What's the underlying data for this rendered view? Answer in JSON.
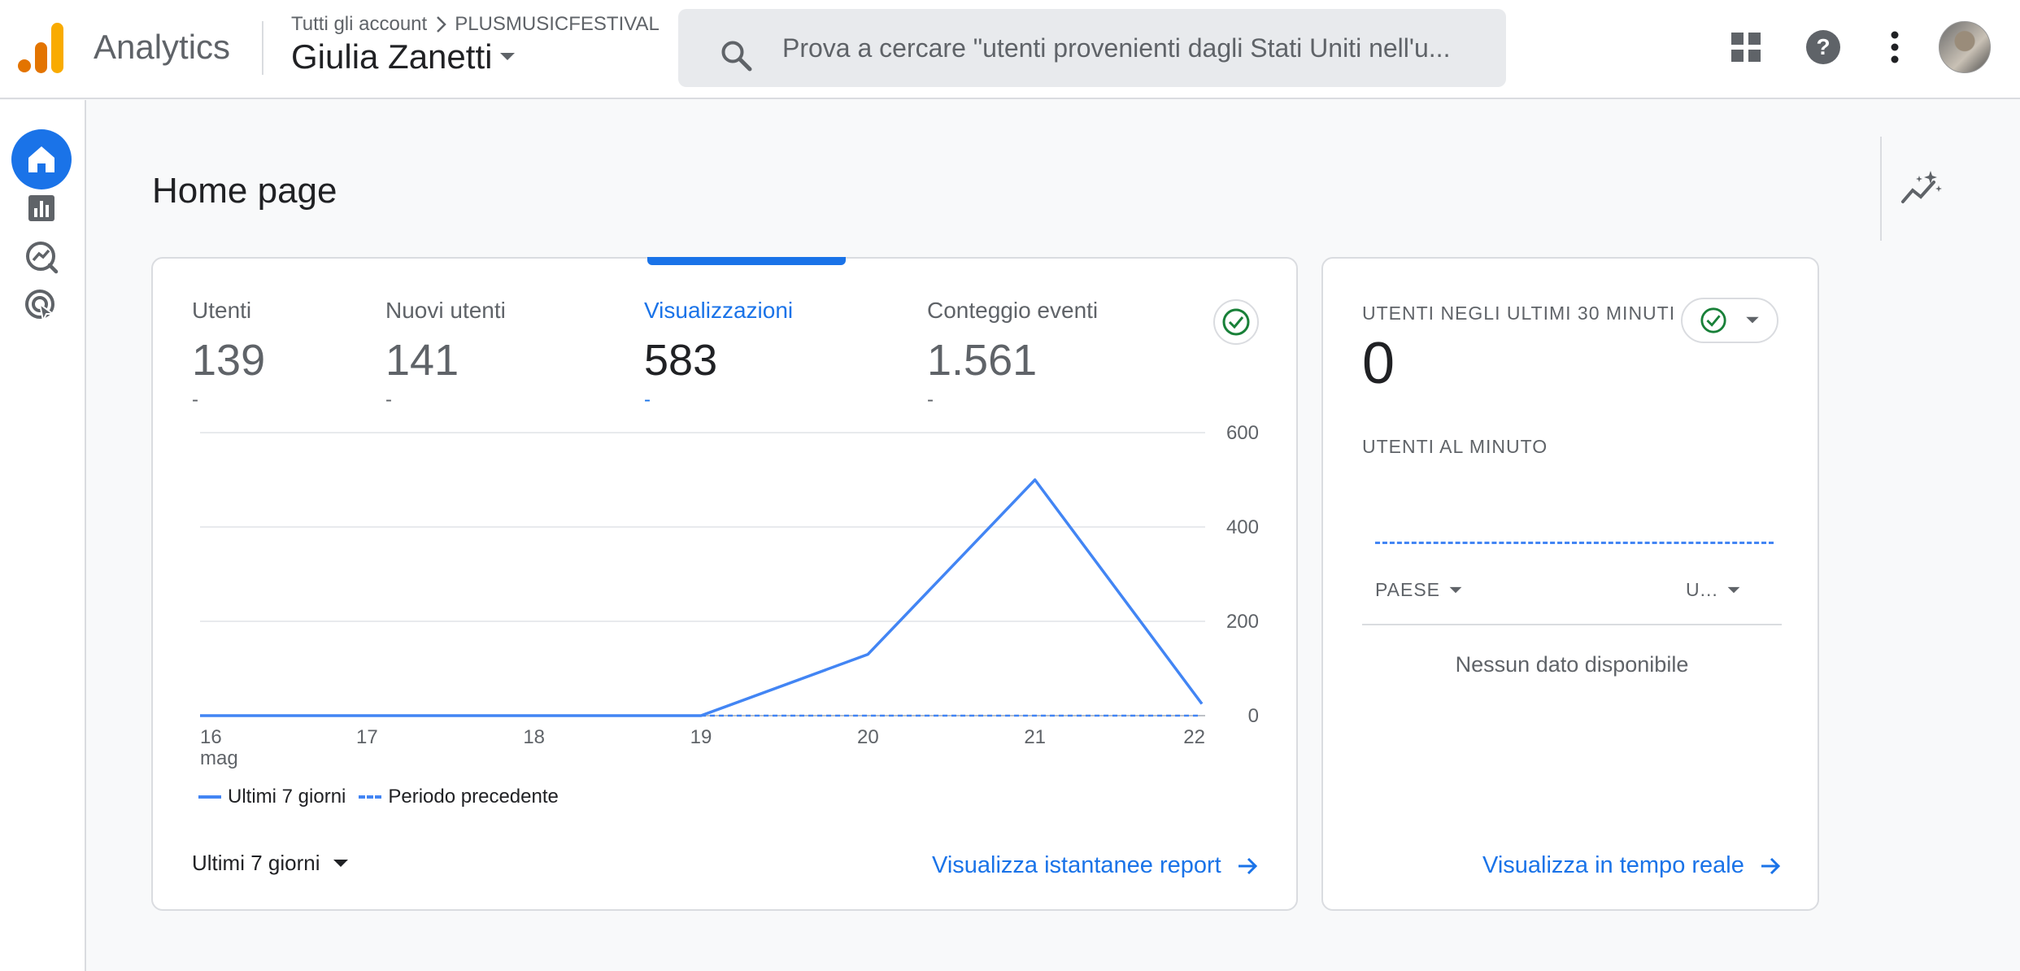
{
  "header": {
    "app_title": "Analytics",
    "breadcrumb_root": "Tutti gli account",
    "breadcrumb_property": "PLUSMUSICFESTIVAL",
    "account_name": "Giulia Zanetti",
    "search_placeholder": "Prova a cercare \"utenti provenienti dagli Stati Uniti nell'u...",
    "icons": [
      "apps-grid-icon",
      "help-icon",
      "more-vert-icon"
    ]
  },
  "sidebar": {
    "items": [
      {
        "icon": "home-icon",
        "active": true
      },
      {
        "icon": "bar-chart-icon",
        "active": false
      },
      {
        "icon": "explore-icon",
        "active": false
      },
      {
        "icon": "advertising-icon",
        "active": false
      }
    ]
  },
  "page": {
    "title": "Home page"
  },
  "overview": {
    "metrics": [
      {
        "label": "Utenti",
        "value": "139",
        "delta": "-"
      },
      {
        "label": "Nuovi utenti",
        "value": "141",
        "delta": "-"
      },
      {
        "label": "Visualizzazioni",
        "value": "583",
        "delta": "-",
        "active": true
      },
      {
        "label": "Conteggio eventi",
        "value": "1.561",
        "delta": "-"
      }
    ],
    "range_label": "Ultimi 7 giorni",
    "link_label": "Visualizza istantanee report"
  },
  "chart_data": {
    "type": "line",
    "x": [
      "16",
      "17",
      "18",
      "19",
      "20",
      "21",
      "22"
    ],
    "x_sublabels": [
      "mag",
      "",
      "",
      "",
      "",
      "",
      ""
    ],
    "series": [
      {
        "name": "Ultimi 7 giorni",
        "values": [
          0,
          0,
          0,
          0,
          130,
          500,
          25
        ],
        "style": "solid",
        "color": "#4285f4"
      },
      {
        "name": "Periodo precedente",
        "values": [
          0,
          0,
          0,
          0,
          0,
          0,
          0
        ],
        "style": "dashed",
        "color": "#4285f4"
      }
    ],
    "y_ticks": [
      0,
      200,
      400,
      600
    ],
    "ylim": [
      0,
      600
    ],
    "y_axis_side": "right",
    "grid": true,
    "legend": "bottom-left"
  },
  "realtime": {
    "title": "UTENTI NEGLI ULTIMI 30 MINUTI",
    "value": "0",
    "subtitle": "UTENTI AL MINUTO",
    "col_country": "PAESE",
    "col_users": "U...",
    "empty": "Nessun dato disponibile",
    "link_label": "Visualizza in tempo reale"
  },
  "colors": {
    "accent": "#1a73e8",
    "line": "#4285f4",
    "check": "#188038",
    "logo_orange": "#f9ab00",
    "logo_dark_orange": "#e37400"
  }
}
